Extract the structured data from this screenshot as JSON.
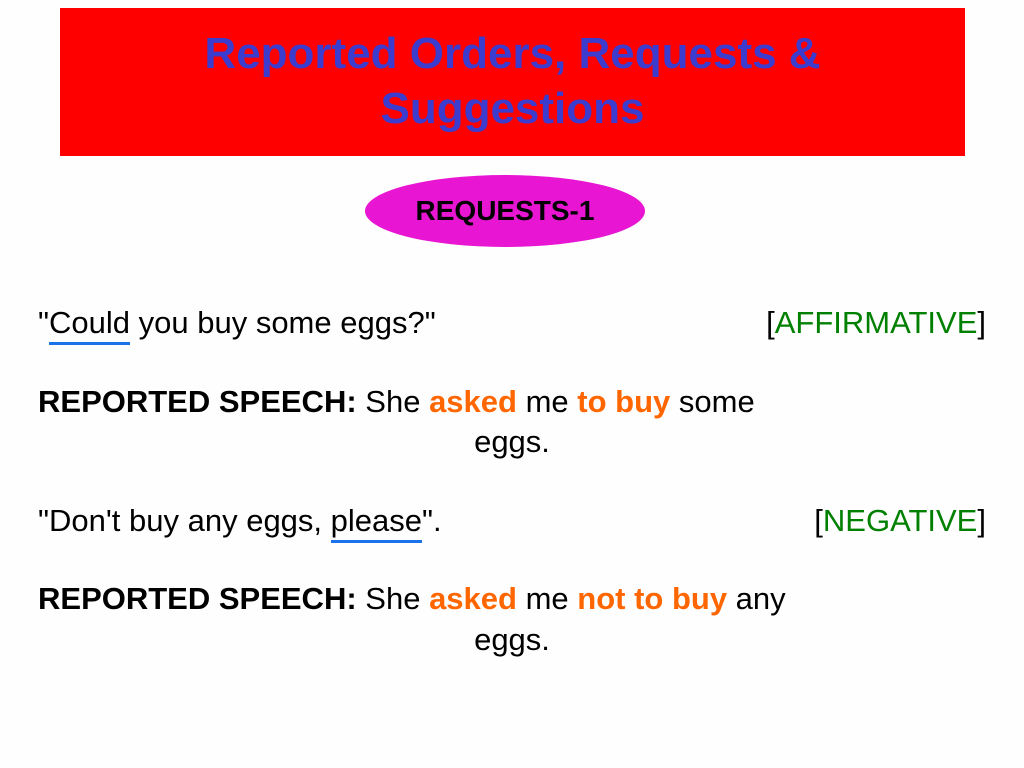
{
  "title": "Reported Orders, Requests & Suggestions",
  "subtitle": "Requests-1",
  "affirmative": {
    "quote_could": "Could",
    "quote_rest": " you buy some eggs?\"",
    "quote_open": "\"",
    "tag": "[AFFIRMATIVE]",
    "rs_label": "REPORTED SPEECH:",
    "rs_part1": " She ",
    "rs_asked": "asked",
    "rs_part2": " me ",
    "rs_tobuy": "to buy",
    "rs_part3": " some",
    "rs_end": "eggs."
  },
  "negative": {
    "quote_start": "\"Don't buy any eggs, ",
    "quote_please": "please",
    "quote_close": "\".",
    "tag": "[NEGATIVE]",
    "rs_label": "REPORTED SPEECH:",
    "rs_part1": " She ",
    "rs_asked": "asked",
    "rs_part2": " me ",
    "rs_notbuy": "not to buy",
    "rs_part3": " any",
    "rs_end": "eggs."
  }
}
